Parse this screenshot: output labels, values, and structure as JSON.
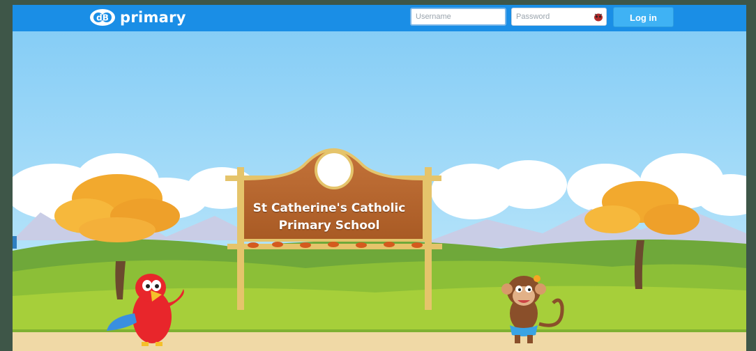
{
  "header": {
    "logo_mark": "dB",
    "logo_text": "primary",
    "username_placeholder": "Username",
    "password_placeholder": "Password",
    "login_label": "Log in"
  },
  "sign": {
    "line1": "St Catherine's Catholic",
    "line2": "Primary School"
  },
  "colors": {
    "topbar": "#1a8ee6",
    "login_button": "#3fb2f4",
    "sky": "#8fd0f5",
    "grass": "#9cc83a",
    "sign_wood": "#b8652c"
  }
}
